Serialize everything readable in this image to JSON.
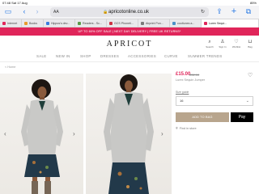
{
  "status_bar": {
    "time": "07:48",
    "date": "Sat 17 Aug",
    "battery": "85%"
  },
  "browser": {
    "text_size_label": "AA",
    "url": "apricotonline.co.uk",
    "tabs": [
      {
        "label": "Internet"
      },
      {
        "label": "Books"
      },
      {
        "label": "Hippus's dev..."
      },
      {
        "label": "Readers - Sc..."
      },
      {
        "label": "GCS Phoneti..."
      },
      {
        "label": "Airprint Pon..."
      },
      {
        "label": "cooltunes a..."
      },
      {
        "label": "Lurex Sequi..."
      }
    ]
  },
  "promo": {
    "text": "UP TO 60% OFF SALE  |  NEXT DAY DELIVERY  |  FREE UK RETURNS*"
  },
  "header": {
    "logo": "APRICOT",
    "icons": [
      {
        "name": "search-icon",
        "glyph": "⌕",
        "label": "Search"
      },
      {
        "name": "account-icon",
        "glyph": "♙",
        "label": "Sign In"
      },
      {
        "name": "wishlist-icon",
        "glyph": "♡",
        "label": "Wishlist"
      },
      {
        "name": "bag-icon",
        "glyph": "⊔",
        "label": "Bag"
      }
    ]
  },
  "nav": {
    "items": [
      "SALE",
      "NEW IN",
      "SHOP",
      "DRESSES",
      "ACCESSORIES",
      "CURVE",
      "SUMMER TRENDS"
    ]
  },
  "breadcrumb": {
    "back": "< Home"
  },
  "product": {
    "price": "£15.00",
    "was_price": "£32.00",
    "name": "Lurex Sequin Jumper",
    "size_guide": "Size guide",
    "size_value": "16",
    "add_to_bag": "ADD TO BAG",
    "apple_pay": " Pay",
    "find_in_store": "Find in store"
  },
  "colors": {
    "accent": "#e0255a",
    "bag_button": "#b8a58d",
    "ios_blue": "#2a7ae4"
  }
}
